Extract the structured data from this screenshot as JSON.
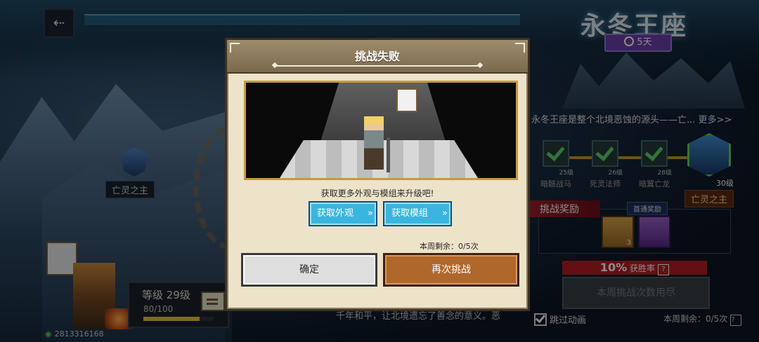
{
  "dialog": {
    "title": "挑战失败",
    "hint": "获取更多外观与模组来升级吧!",
    "btn_appearance": "获取外观",
    "btn_module": "获取模组",
    "weekly_remaining": "本周剩余：0/5次",
    "btn_ok": "确定",
    "btn_retry": "再次挑战"
  },
  "map": {
    "node_label": "亡灵之主",
    "level_title": "等级 29级",
    "level_exp": "80/100",
    "level_progress": 0.8,
    "player_id": "2813316168",
    "bottom_text": "千年和平，让北境遗忘了善念的意义。恶"
  },
  "right_panel": {
    "title": "永冬王座",
    "days": "5天",
    "description": "永冬王座是整个北境恶蚀的源头——亡...",
    "more": "更多>>",
    "bosses": [
      {
        "name": "暗骸战马",
        "level": "25级"
      },
      {
        "name": "死灵法师",
        "level": "26级"
      },
      {
        "name": "暗翼亡龙",
        "level": "28级"
      },
      {
        "name": "亡灵之主",
        "level": "30级"
      }
    ],
    "rewards_title": "挑战奖励",
    "first_clear": "首通奖励",
    "chest_count": "3",
    "winrate": "10%",
    "winrate_label": "获胜率",
    "question": "?",
    "disabled_btn": "本周挑战次数用尽",
    "skip_anim": "跳过动画",
    "weekly_remaining": "本周剩余：0/5次"
  },
  "colors": {
    "retry": "#b0672c",
    "get_btn": "#3ab5e0",
    "winrate": "#b61c24",
    "days_badge": "#6a3fa8"
  }
}
